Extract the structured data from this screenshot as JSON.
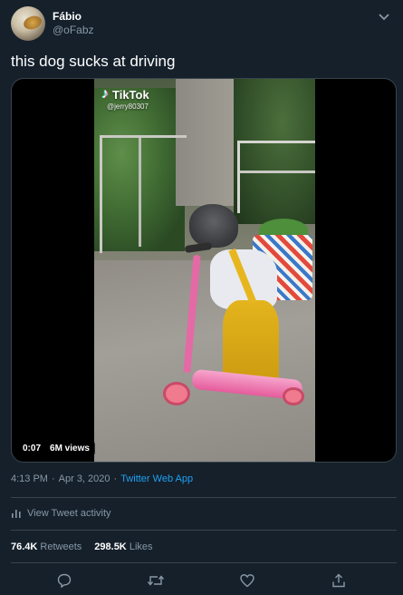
{
  "author": {
    "display_name": "Fábio",
    "handle": "@oFabz"
  },
  "tweet": {
    "text": "this dog sucks at driving"
  },
  "media": {
    "watermark_brand": "TikTok",
    "watermark_user": "@jerry80307",
    "duration": "0:07",
    "views": "6M views"
  },
  "meta": {
    "time": "4:13 PM",
    "separator1": "·",
    "date": "Apr 3, 2020",
    "separator2": "·",
    "source": "Twitter Web App"
  },
  "activity": {
    "label": "View Tweet activity"
  },
  "stats": {
    "retweets_count": "76.4K",
    "retweets_label": "Retweets",
    "likes_count": "298.5K",
    "likes_label": "Likes"
  },
  "icons": {
    "more": "chevron-down-icon",
    "reply": "reply-icon",
    "retweet": "retweet-icon",
    "like": "heart-icon",
    "share": "share-icon",
    "analytics": "analytics-icon"
  },
  "colors": {
    "background": "#15202b",
    "text_primary": "#ffffff",
    "text_secondary": "#8899a6",
    "accent": "#1da1f2",
    "border": "#38444d"
  }
}
